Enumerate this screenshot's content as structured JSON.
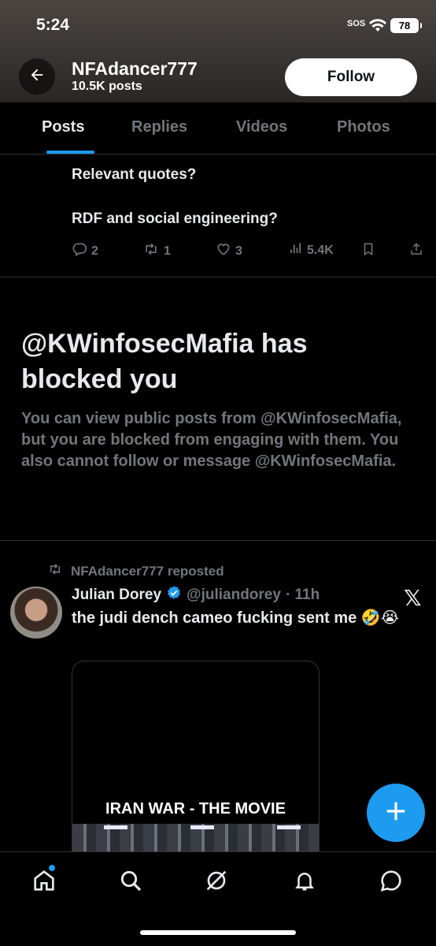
{
  "status_bar": {
    "time": "5:24",
    "sos": "SOS",
    "battery": "78"
  },
  "header": {
    "name": "NFAdancer777",
    "post_count": "10.5K posts",
    "follow_label": "Follow"
  },
  "tabs": [
    {
      "label": "Posts",
      "active": true
    },
    {
      "label": "Replies",
      "active": false
    },
    {
      "label": "Videos",
      "active": false
    },
    {
      "label": "Photos",
      "active": false
    }
  ],
  "tweet1": {
    "lines": [
      "Relevant quotes?",
      "RDF and social engineering?"
    ],
    "replies": "2",
    "reposts": "1",
    "likes": "3",
    "views": "5.4K"
  },
  "blocked": {
    "title": "@KWinfosecMafia has blocked you",
    "description": "You can view public posts from @KWinfosecMafia, but you are blocked from engaging with them. You also cannot follow or message @KWinfosecMafia."
  },
  "tweet2": {
    "repost_label": "NFAdancer777 reposted",
    "author_name": "Julian Dorey",
    "handle": "@juliandorey",
    "time": "· 11h",
    "text": "the judi dench cameo fucking sent me 🤣😭",
    "media_title": "IRAN WAR - THE MOVIE"
  },
  "colors": {
    "accent": "#1d9bf0",
    "muted": "#71767b",
    "text": "#e7e9ea",
    "background": "#000000"
  },
  "icons": {
    "back": "arrow-left-icon",
    "reply": "comment-icon",
    "repost": "repost-icon",
    "like": "heart-icon",
    "views": "bar-chart-icon",
    "bookmark": "bookmark-icon",
    "share": "share-icon",
    "home": "home-icon",
    "search": "search-icon",
    "grok": "grok-icon",
    "notifications": "bell-icon",
    "messages": "message-icon",
    "compose": "plus-icon"
  }
}
